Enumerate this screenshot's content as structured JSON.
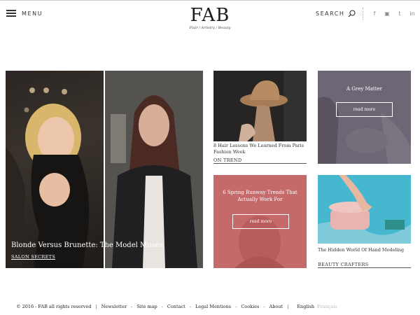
{
  "header": {
    "menu_label": "MENU",
    "logo_mark": "FAB",
    "logo_tagline": "Flair / Artistry / Beauty",
    "search_label": "SEARCH",
    "socials": [
      "f",
      "▣",
      "t",
      "in"
    ]
  },
  "tiles": {
    "feature": {
      "caption": "Blonde Versus Brunette: The Model Muses",
      "category": "SALON SECRETS"
    },
    "hat": {
      "caption": "8 Hair Lessons We Learned From Paris Fashion Week",
      "category": "ON TREND"
    },
    "grey": {
      "title": "A Grey Matter",
      "button": "read more"
    },
    "runway": {
      "title": "6 Spring Runway Trends That Actually Work For",
      "button": "read more"
    },
    "phone": {
      "caption": "The Hidden World Of Hand Modeling",
      "category": "BEAUTY CRAFTERS"
    }
  },
  "footer": {
    "copyright": "© 2016 - FAB all rights reserved",
    "links": [
      "Newsletter",
      "Site map",
      "Contact",
      "Legal Mentions",
      "Cookies",
      "About"
    ],
    "separator": "-",
    "bar": "|",
    "lang_active": "English",
    "lang_inactive": "Français"
  },
  "colors": {
    "grey_tile": "#6d6674",
    "runway_tile": "#c46a6a",
    "phone_tile": "#3fb0c9"
  }
}
